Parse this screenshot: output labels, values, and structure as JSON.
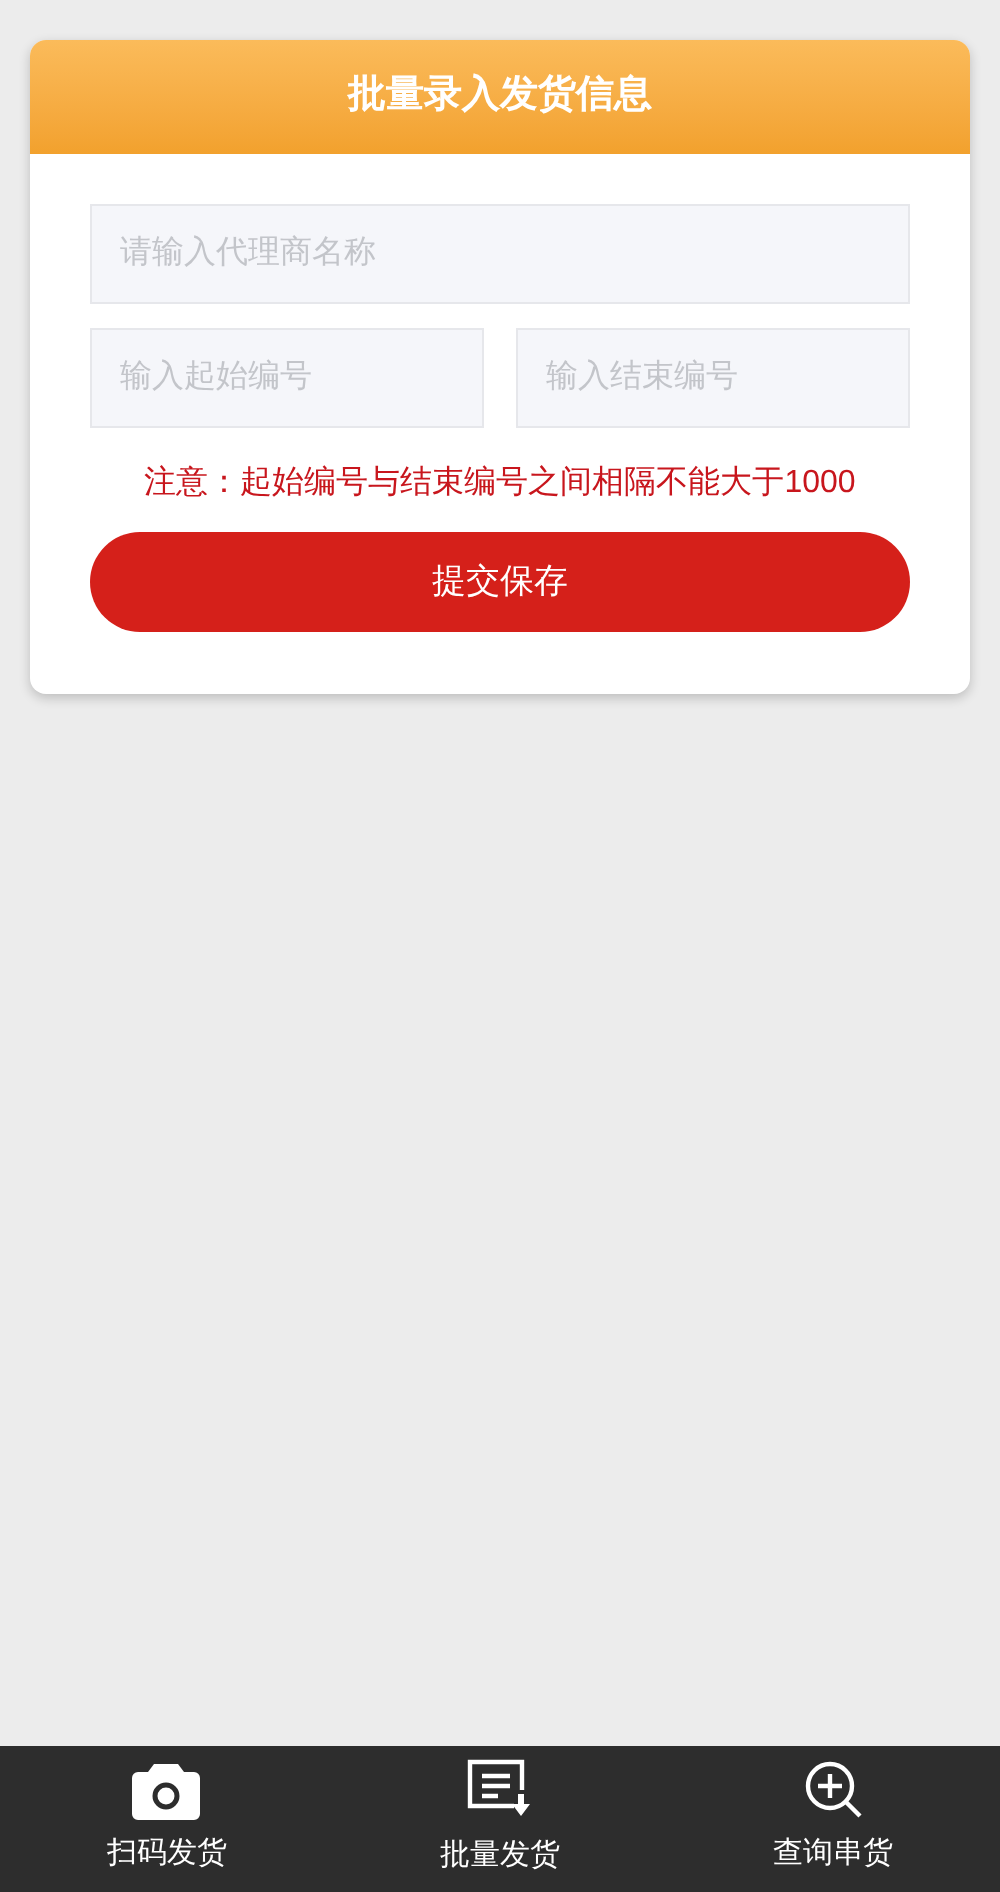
{
  "card": {
    "title": "批量录入发货信息",
    "fields": [
      {
        "placeholder": "请输入代理商名称"
      }
    ],
    "range_fields": [
      {
        "placeholder": "输入起始编号"
      },
      {
        "placeholder": "输入结束编号"
      }
    ],
    "notice": "注意：起始编号与结束编号之间相隔不能大于1000",
    "submit_button": "提交保存"
  },
  "bottom_nav": [
    {
      "kind": "camera",
      "label": "扫码发货"
    },
    {
      "kind": "document",
      "label": "批量发货"
    },
    {
      "kind": "search",
      "label": "查询串货"
    }
  ]
}
